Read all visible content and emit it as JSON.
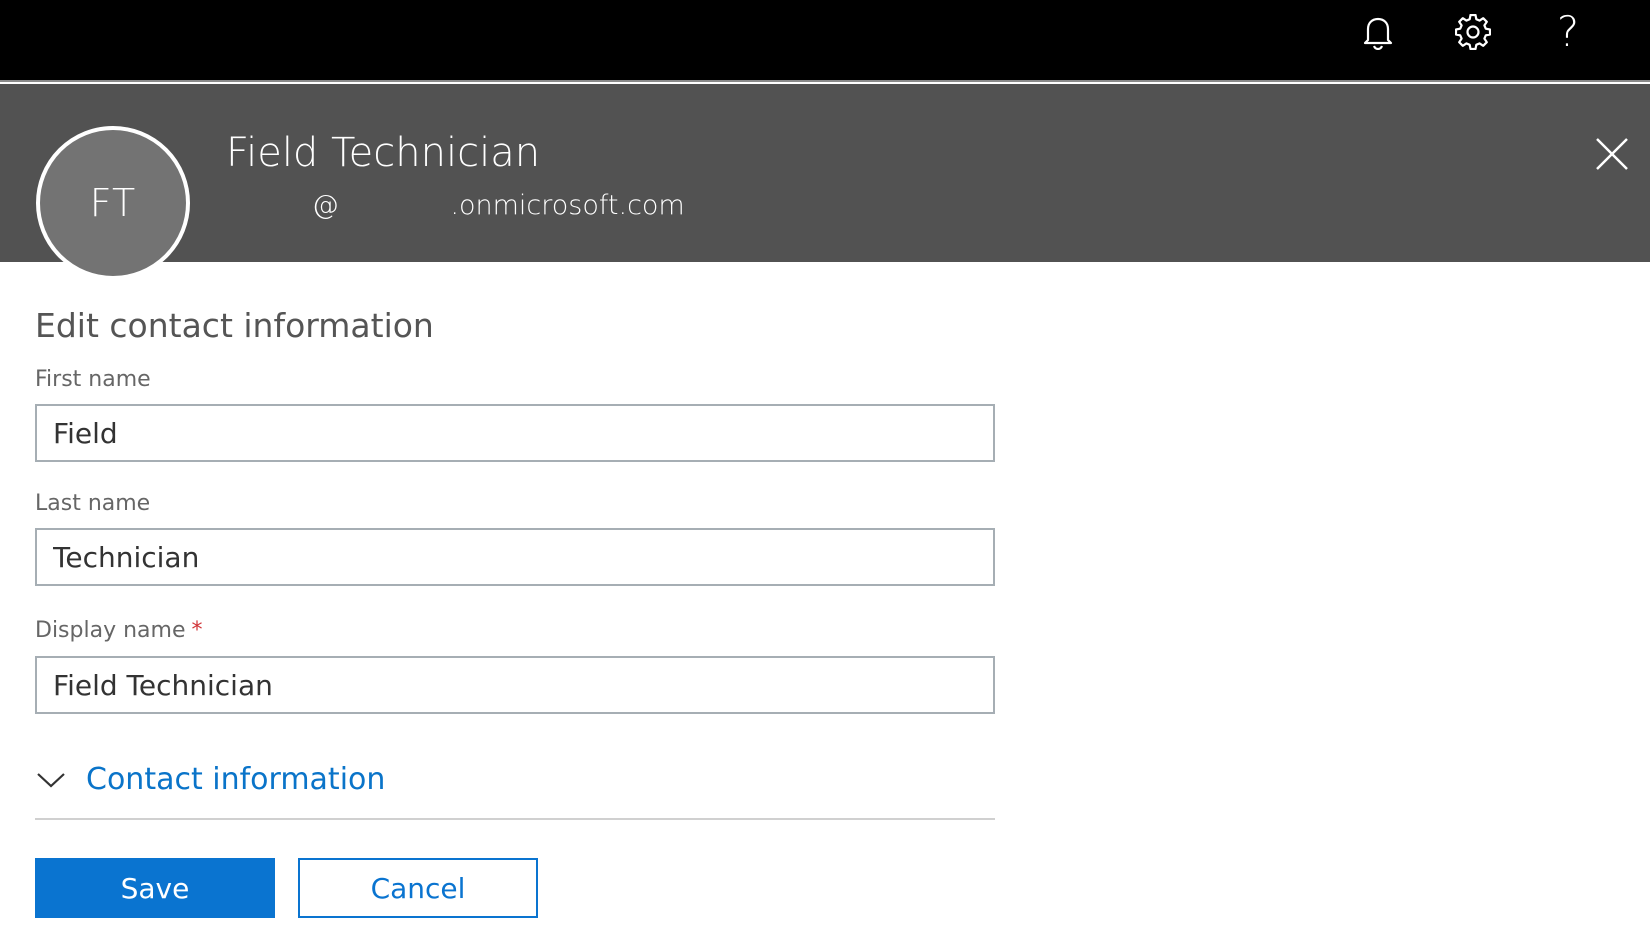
{
  "topbar": {
    "icons": [
      "bell-icon",
      "gear-icon",
      "help-icon"
    ],
    "help_glyph": "?"
  },
  "header": {
    "avatar_initials": "FT",
    "display_name": "Field Technician",
    "email": "          @             .onmicrosoft.com"
  },
  "form": {
    "title": "Edit contact information",
    "first_name": {
      "label": "First name",
      "value": "Field"
    },
    "last_name": {
      "label": "Last name",
      "value": "Technician"
    },
    "display_name": {
      "label": "Display name",
      "required_marker": "*",
      "value": "Field Technician"
    },
    "contact_section": {
      "label": "Contact information",
      "expanded": false
    }
  },
  "actions": {
    "save_label": "Save",
    "cancel_label": "Cancel"
  },
  "colors": {
    "topbar_bg": "#000000",
    "header_bg": "#525252",
    "accent_blue": "#0a74d0",
    "link_blue": "#0a74c9",
    "required_red": "#d13438"
  }
}
